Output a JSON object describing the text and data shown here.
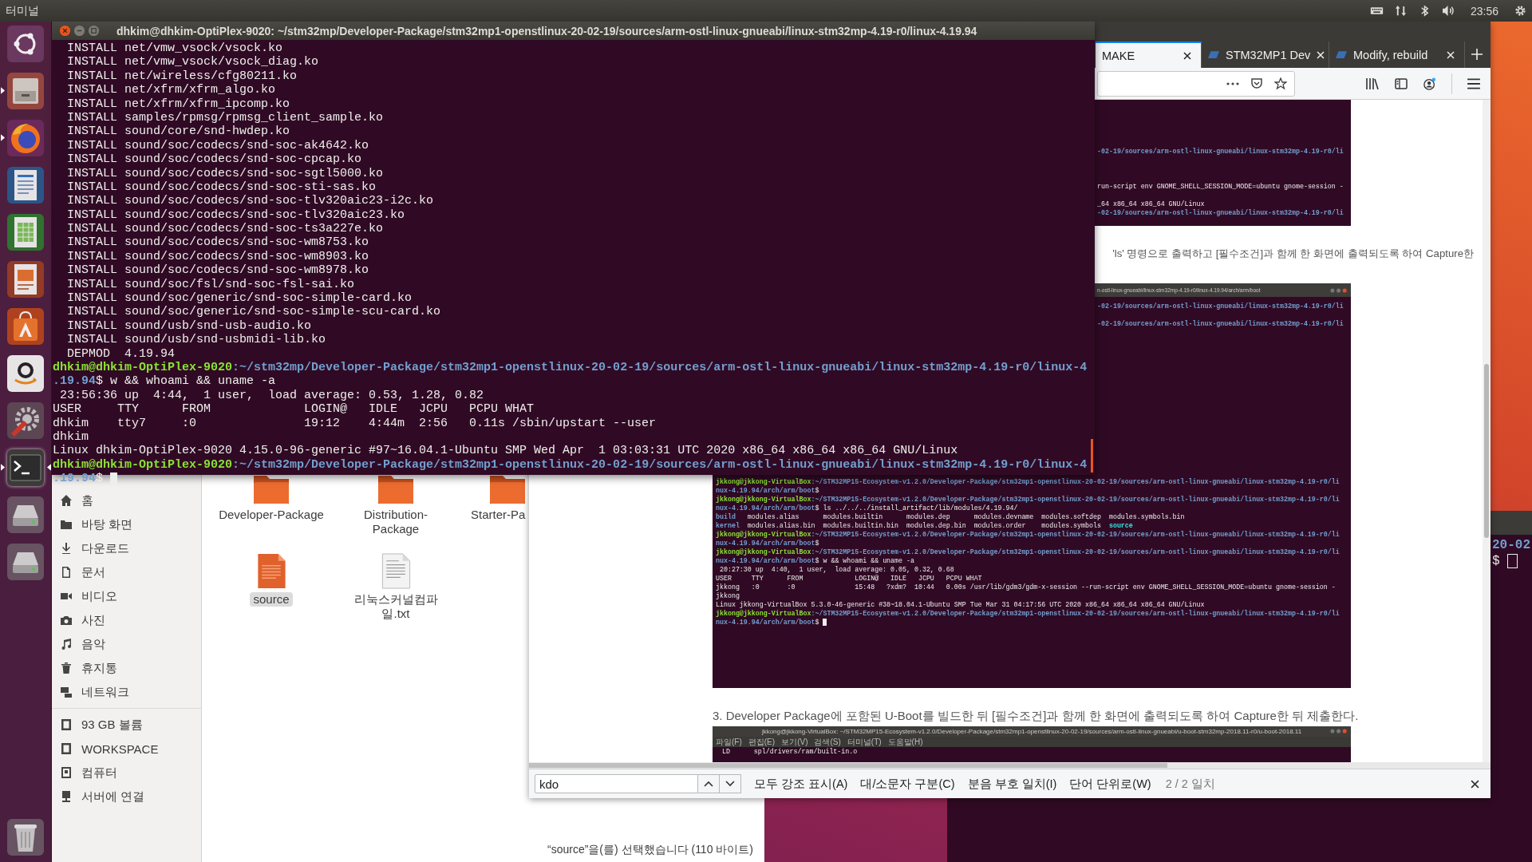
{
  "top_bar": {
    "app_name": "터미널",
    "time": "23:56"
  },
  "launcher": [
    {
      "running": false,
      "active": false
    },
    {
      "running": true,
      "active": false
    },
    {
      "running": true,
      "active": false
    },
    {
      "running": false,
      "active": false
    },
    {
      "running": false,
      "active": false
    },
    {
      "running": false,
      "active": false
    },
    {
      "running": false,
      "active": false
    },
    {
      "running": false,
      "active": false
    },
    {
      "running": false,
      "active": false
    },
    {
      "running": true,
      "active": true
    },
    {
      "running": false,
      "active": false
    },
    {
      "running": false,
      "active": false
    },
    {
      "running": false,
      "active": false
    }
  ],
  "terminal": {
    "title": "dhkim@dhkim-OptiPlex-9020: ~/stm32mp/Developer-Package/stm32mp1-openstlinux-20-02-19/sources/arm-ostl-linux-gnueabi/linux-stm32mp-4.19-r0/linux-4.19.94",
    "lines": [
      [
        {
          "kind": "plain",
          "text": "  INSTALL net/vmw_vsock/vsock.ko"
        }
      ],
      [
        {
          "kind": "plain",
          "text": "  INSTALL net/vmw_vsock/vsock_diag.ko"
        }
      ],
      [
        {
          "kind": "plain",
          "text": "  INSTALL net/wireless/cfg80211.ko"
        }
      ],
      [
        {
          "kind": "plain",
          "text": "  INSTALL net/xfrm/xfrm_algo.ko"
        }
      ],
      [
        {
          "kind": "plain",
          "text": "  INSTALL net/xfrm/xfrm_ipcomp.ko"
        }
      ],
      [
        {
          "kind": "plain",
          "text": "  INSTALL samples/rpmsg/rpmsg_client_sample.ko"
        }
      ],
      [
        {
          "kind": "plain",
          "text": "  INSTALL sound/core/snd-hwdep.ko"
        }
      ],
      [
        {
          "kind": "plain",
          "text": "  INSTALL sound/soc/codecs/snd-soc-ak4642.ko"
        }
      ],
      [
        {
          "kind": "plain",
          "text": "  INSTALL sound/soc/codecs/snd-soc-cpcap.ko"
        }
      ],
      [
        {
          "kind": "plain",
          "text": "  INSTALL sound/soc/codecs/snd-soc-sgtl5000.ko"
        }
      ],
      [
        {
          "kind": "plain",
          "text": "  INSTALL sound/soc/codecs/snd-soc-sti-sas.ko"
        }
      ],
      [
        {
          "kind": "plain",
          "text": "  INSTALL sound/soc/codecs/snd-soc-tlv320aic23-i2c.ko"
        }
      ],
      [
        {
          "kind": "plain",
          "text": "  INSTALL sound/soc/codecs/snd-soc-tlv320aic23.ko"
        }
      ],
      [
        {
          "kind": "plain",
          "text": "  INSTALL sound/soc/codecs/snd-soc-ts3a227e.ko"
        }
      ],
      [
        {
          "kind": "plain",
          "text": "  INSTALL sound/soc/codecs/snd-soc-wm8753.ko"
        }
      ],
      [
        {
          "kind": "plain",
          "text": "  INSTALL sound/soc/codecs/snd-soc-wm8903.ko"
        }
      ],
      [
        {
          "kind": "plain",
          "text": "  INSTALL sound/soc/codecs/snd-soc-wm8978.ko"
        }
      ],
      [
        {
          "kind": "plain",
          "text": "  INSTALL sound/soc/fsl/snd-soc-fsl-sai.ko"
        }
      ],
      [
        {
          "kind": "plain",
          "text": "  INSTALL sound/soc/generic/snd-soc-simple-card.ko"
        }
      ],
      [
        {
          "kind": "plain",
          "text": "  INSTALL sound/soc/generic/snd-soc-simple-scu-card.ko"
        }
      ],
      [
        {
          "kind": "plain",
          "text": "  INSTALL sound/usb/snd-usb-audio.ko"
        }
      ],
      [
        {
          "kind": "plain",
          "text": "  INSTALL sound/usb/snd-usbmidi-lib.ko"
        }
      ],
      [
        {
          "kind": "plain",
          "text": "  DEPMOD  4.19.94"
        }
      ],
      [
        {
          "kind": "user",
          "text": "dhkim@dhkim-OptiPlex-9020"
        },
        {
          "kind": "path",
          "text": ":~/stm32mp/Developer-Package/stm32mp1-openstlinux-20-02-19/sources/arm-ostl-linux-gnueabi/linux-stm32mp-4.19-r0/linux-4"
        }
      ],
      [
        {
          "kind": "path",
          "text": ".19.94"
        },
        {
          "kind": "plain",
          "text": "$ w && whoami && uname -a"
        }
      ],
      [
        {
          "kind": "plain",
          "text": " 23:56:36 up  4:44,  1 user,  load average: 0.53, 1.28, 0.82"
        }
      ],
      [
        {
          "kind": "plain",
          "text": "USER     TTY      FROM             LOGIN@   IDLE   JCPU   PCPU WHAT"
        }
      ],
      [
        {
          "kind": "plain",
          "text": "dhkim    tty7     :0               19:12    4:44m  2:56   0.11s /sbin/upstart --user"
        }
      ],
      [
        {
          "kind": "plain",
          "text": "dhkim"
        }
      ],
      [
        {
          "kind": "plain",
          "text": "Linux dhkim-OptiPlex-9020 4.15.0-96-generic #97~16.04.1-Ubuntu SMP Wed Apr  1 03:03:31 UTC 2020 x86_64 x86_64 x86_64 GNU/Linux"
        }
      ],
      [
        {
          "kind": "user",
          "text": "dhkim@dhkim-OptiPlex-9020"
        },
        {
          "kind": "path",
          "text": ":~/stm32mp/Developer-Package/stm32mp1-openstlinux-20-02-19/sources/arm-ostl-linux-gnueabi/linux-stm32mp-4.19-r0/linux-4"
        }
      ],
      [
        {
          "kind": "path",
          "text": ".19.94"
        },
        {
          "kind": "plain",
          "text": "$"
        }
      ]
    ],
    "cursor_visible": true
  },
  "file_manager": {
    "places": [
      "홈",
      "바탕 화면",
      "다운로드",
      "문서",
      "비디오",
      "사진",
      "음악",
      "휴지통",
      "네트워크"
    ],
    "devices": [
      "93 GB 볼륨",
      "WORKSPACE",
      "컴퓨터",
      "서버에 연결"
    ],
    "items": [
      {
        "name": "Developer-Package",
        "kind": "folder",
        "selected": false
      },
      {
        "name": "Distribution-Package",
        "kind": "folder",
        "selected": false
      },
      {
        "name": "Starter-Pa",
        "kind": "folder",
        "selected": false
      },
      {
        "name": "source",
        "kind": "source",
        "selected": true
      },
      {
        "name": "리눅스커널컴파일.txt",
        "kind": "text",
        "selected": false
      }
    ],
    "status": "“source”을(를) 선택했습니다 (110 바이트)"
  },
  "browser": {
    "tabs": [
      {
        "label": "MAKE",
        "selected": true
      },
      {
        "label": "STM32MP1 Dev",
        "selected": false
      },
      {
        "label": "Modify, rebuild",
        "selected": false
      }
    ],
    "page": {
      "image_1": {
        "lines": [
          {
            "kind": "path",
            "text": "-02-19/sources/arm-ostl-linux-gnueabi/linux-stm32mp-4.19-r0/li"
          },
          {
            "kind": "plain",
            "text": "run-script env GNOME_SHELL_SESSION_MODE=ubuntu gnome-session -"
          },
          {
            "kind": "plain",
            "text": "_64 x86_64 x86_64 GNU/Linux"
          },
          {
            "kind": "path",
            "text": "-02-19/sources/arm-ostl-linux-gnueabi/linux-stm32mp-4.19-r0/li"
          }
        ]
      },
      "paragraph_1": "'ls' 명령으로 출력하고 [필수조건]과 함께 한 화면에 출력되도록 하여 Capture한",
      "image_2": {
        "title": "n-ostl-linux-gnueabi/linux-stm32mp-4.19-r0/linux-4.19.94/arch/arm/boot",
        "cut_lines": [
          {
            "kind": "path",
            "text": "-02-19/sources/arm-ostl-linux-gnueabi/linux-stm32mp-4.19-r0/li"
          },
          {
            "kind": "path",
            "text": "-02-19/sources/arm-ostl-linux-gnueabi/linux-stm32mp-4.19-r0/li"
          }
        ],
        "lines": [
          [
            {
              "kind": "user",
              "text": "jkkong@jkkong-VirtualBox"
            },
            {
              "kind": "path",
              "text": ":~/STM32MP15-Ecosystem-v1.2.0/Developer-Package/stm32mp1-openstlinux-20-02-19/sources/arm-ostl-linux-gnueabi/linux-stm32mp-4.19-r0/li"
            }
          ],
          [
            {
              "kind": "path",
              "text": "nux-4.19.94/arch/arm/boot"
            },
            {
              "kind": "plain",
              "text": "$"
            }
          ],
          [
            {
              "kind": "user",
              "text": "jkkong@jkkong-VirtualBox"
            },
            {
              "kind": "path",
              "text": ":~/STM32MP15-Ecosystem-v1.2.0/Developer-Package/stm32mp1-openstlinux-20-02-19/sources/arm-ostl-linux-gnueabi/linux-stm32mp-4.19-r0/li"
            }
          ],
          [
            {
              "kind": "path",
              "text": "nux-4.19.94/arch/arm/boot"
            },
            {
              "kind": "plain",
              "text": "$ ls ../../../install_artifact/lib/modules/4.19.94/"
            }
          ],
          [
            {
              "kind": "dir",
              "text": "build"
            },
            {
              "kind": "plain",
              "text": "   modules.alias      modules.builtin      modules.dep      modules.devname  modules.softdep  modules.symbols.bin"
            }
          ],
          [
            {
              "kind": "dir",
              "text": "kernel"
            },
            {
              "kind": "plain",
              "text": "  modules.alias.bin  modules.builtin.bin  modules.dep.bin  modules.order    modules.symbols  "
            },
            {
              "kind": "link",
              "text": "source"
            }
          ],
          [
            {
              "kind": "user",
              "text": "jkkong@jkkong-VirtualBox"
            },
            {
              "kind": "path",
              "text": ":~/STM32MP15-Ecosystem-v1.2.0/Developer-Package/stm32mp1-openstlinux-20-02-19/sources/arm-ostl-linux-gnueabi/linux-stm32mp-4.19-r0/li"
            }
          ],
          [
            {
              "kind": "path",
              "text": "nux-4.19.94/arch/arm/boot"
            },
            {
              "kind": "plain",
              "text": "$"
            }
          ],
          [
            {
              "kind": "user",
              "text": "jkkong@jkkong-VirtualBox"
            },
            {
              "kind": "path",
              "text": ":~/STM32MP15-Ecosystem-v1.2.0/Developer-Package/stm32mp1-openstlinux-20-02-19/sources/arm-ostl-linux-gnueabi/linux-stm32mp-4.19-r0/li"
            }
          ],
          [
            {
              "kind": "path",
              "text": "nux-4.19.94/arch/arm/boot"
            },
            {
              "kind": "plain",
              "text": "$ w && whoami && uname -a"
            }
          ],
          [
            {
              "kind": "plain",
              "text": " 20:27:30 up  4:40,  1 user,  load average: 0.05, 0.32, 0.68"
            }
          ],
          [
            {
              "kind": "plain",
              "text": "USER     TTY      FROM             LOGIN@   IDLE   JCPU   PCPU WHAT"
            }
          ],
          [
            {
              "kind": "plain",
              "text": "jkkong   :0       :0               15:48   ?xdm?  10:44   0.00s /usr/lib/gdm3/gdm-x-session --run-script env GNOME_SHELL_SESSION_MODE=ubuntu gnome-session -"
            }
          ],
          [
            {
              "kind": "plain",
              "text": "jkkong"
            }
          ],
          [
            {
              "kind": "plain",
              "text": "Linux jkkong-VirtualBox 5.3.0-46-generic #38~18.04.1-Ubuntu SMP Tue Mar 31 04:17:56 UTC 2020 x86_64 x86_64 x86_64 GNU/Linux"
            }
          ],
          [
            {
              "kind": "user",
              "text": "jkkong@jkkong-VirtualBox"
            },
            {
              "kind": "path",
              "text": ":~/STM32MP15-Ecosystem-v1.2.0/Developer-Package/stm32mp1-openstlinux-20-02-19/sources/arm-ostl-linux-gnueabi/linux-stm32mp-4.19-r0/li"
            }
          ],
          [
            {
              "kind": "path",
              "text": "nux-4.19.94/arch/arm/boot"
            },
            {
              "kind": "plain",
              "text": "$"
            }
          ]
        ],
        "cursor_visible": true
      },
      "paragraph_2": "3. Developer Package에 포함된 U-Boot를 빌드한 뒤 [필수조건]과 함께 한 화면에 출력되도록 하여 Capture한 뒤 제출한다.",
      "image_3": {
        "title": "jkkong@jkkong-VirtualBox: ~/STM32MP15-Ecosystem-v1.2.0/Developer-Package/stm32mp1-openstlinux-20-02-19/sources/arm-ostl-linux-gnueabi/u-boot-stm32mp-2018.11-r0/u-boot-2018.11",
        "menu": [
          "파일(F)",
          "편집(E)",
          "보기(V)",
          "검색(S)",
          "터미널(T)",
          "도움말(H)"
        ],
        "lines": [
          "  LD      spl/drivers/ram/built-in.o"
        ]
      }
    },
    "find_bar": {
      "query": "kdo",
      "options": [
        "모두 강조 표시(A)",
        "대/소문자 구분(C)",
        "분음 부호 일치(I)",
        "단어 단위로(W)"
      ],
      "result": "2 / 2 일치"
    }
  },
  "background_terminal": {
    "lines": [
      [
        {
          "kind": "path",
          "text": "20-02"
        }
      ],
      [
        {
          "kind": "plain",
          "text": "$"
        }
      ]
    ],
    "cursor_visible": true
  }
}
